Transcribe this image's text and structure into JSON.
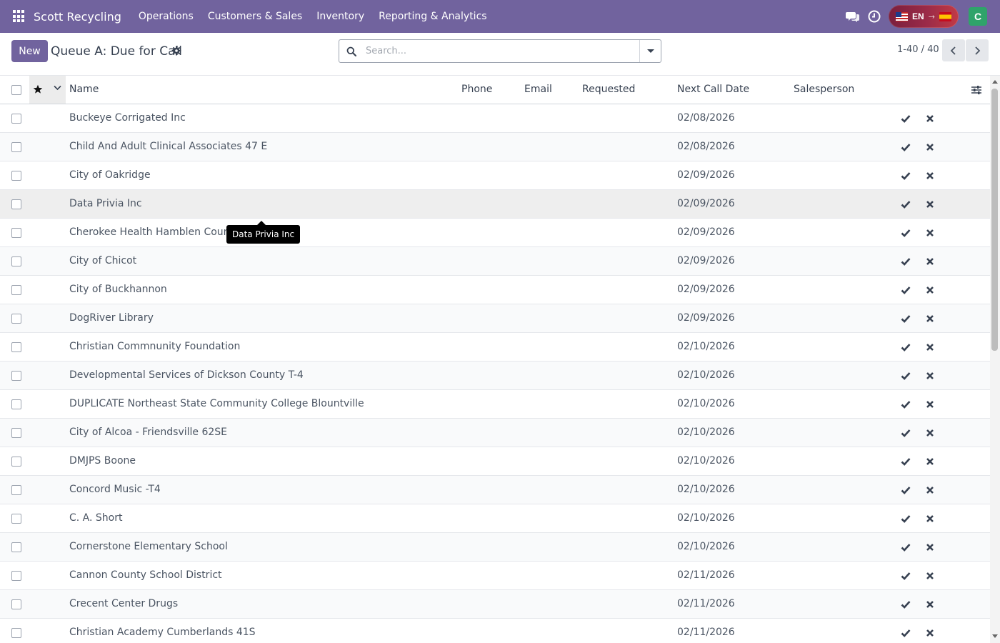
{
  "navbar": {
    "app_name": "Scott Recycling",
    "menu": [
      {
        "label": "Operations"
      },
      {
        "label": "Customers & Sales"
      },
      {
        "label": "Inventory"
      },
      {
        "label": "Reporting & Analytics"
      }
    ],
    "language": {
      "current": "EN",
      "separator": "→"
    },
    "user_initial": "C"
  },
  "control_panel": {
    "new_label": "New",
    "view_title": "Queue A: Due for Call",
    "search_placeholder": "Search...",
    "pager_value": "1-40 / 40"
  },
  "table": {
    "columns": {
      "name": "Name",
      "phone": "Phone",
      "email": "Email",
      "requested": "Requested",
      "next_call_date": "Next Call Date",
      "salesperson": "Salesperson"
    },
    "rows": [
      {
        "name": "Buckeye Corrigated Inc",
        "next_call_date": "02/08/2026"
      },
      {
        "name": "Child And Adult Clinical Associates 47 E",
        "next_call_date": "02/08/2026"
      },
      {
        "name": "City of Oakridge",
        "next_call_date": "02/09/2026"
      },
      {
        "name": "Data Privia Inc",
        "next_call_date": "02/09/2026"
      },
      {
        "name": "Cherokee Health Hamblen County",
        "next_call_date": "02/09/2026"
      },
      {
        "name": "City of Chicot",
        "next_call_date": "02/09/2026"
      },
      {
        "name": "City of Buckhannon",
        "next_call_date": "02/09/2026"
      },
      {
        "name": "DogRiver Library",
        "next_call_date": "02/09/2026"
      },
      {
        "name": "Christian Commnunity Foundation",
        "next_call_date": "02/10/2026"
      },
      {
        "name": "Developmental Services of Dickson County T-4",
        "next_call_date": "02/10/2026"
      },
      {
        "name": "DUPLICATE Northeast State Community College Blountville",
        "next_call_date": "02/10/2026"
      },
      {
        "name": "City of Alcoa - Friendsville 62SE",
        "next_call_date": "02/10/2026"
      },
      {
        "name": "DMJPS Boone",
        "next_call_date": "02/10/2026"
      },
      {
        "name": "Concord Music -T4",
        "next_call_date": "02/10/2026"
      },
      {
        "name": "C. A. Short",
        "next_call_date": "02/10/2026"
      },
      {
        "name": "Cornerstone Elementary School",
        "next_call_date": "02/10/2026"
      },
      {
        "name": "Cannon County School District",
        "next_call_date": "02/11/2026"
      },
      {
        "name": "Crecent Center Drugs",
        "next_call_date": "02/11/2026"
      },
      {
        "name": "Christian Academy Cumberlands 41S",
        "next_call_date": "02/11/2026"
      }
    ]
  },
  "tooltip": {
    "text": "Data Privia Inc"
  },
  "colors": {
    "navbar": "#71639e",
    "primary_button": "#71639e",
    "check": "#374151",
    "avatar": "#2fa36a"
  }
}
